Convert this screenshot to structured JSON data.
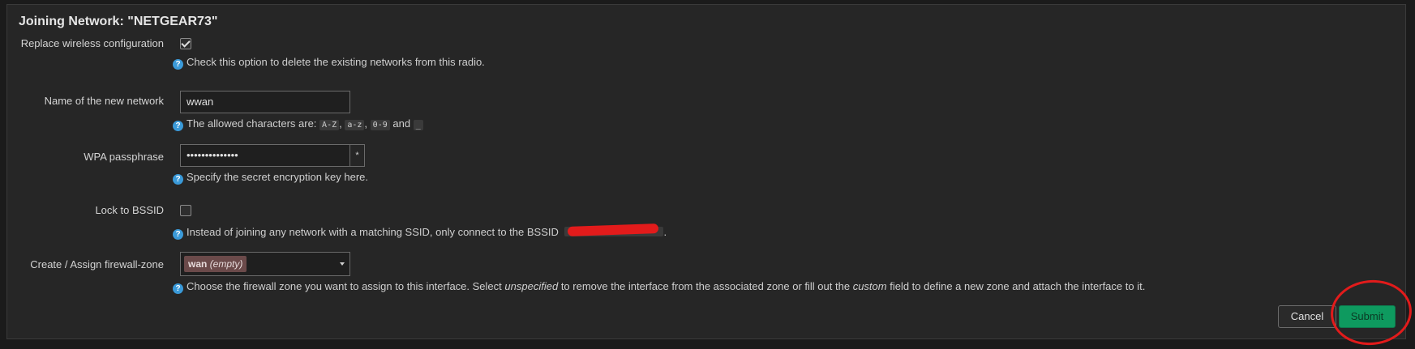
{
  "dialog": {
    "title": "Joining Network: \"NETGEAR73\""
  },
  "fields": {
    "replace": {
      "label": "Replace wireless configuration",
      "checked": true,
      "help": "Check this option to delete the existing networks from this radio."
    },
    "name": {
      "label": "Name of the new network",
      "value": "wwan",
      "help_prefix": "The allowed characters are:",
      "chars": [
        "A-Z",
        "a-z",
        "0-9",
        "_"
      ],
      "sep1": ",",
      "sep2": ",",
      "and": "and"
    },
    "passphrase": {
      "label": "WPA passphrase",
      "value": "••••••••••••••",
      "reveal_glyph": "*",
      "help": "Specify the secret encryption key here."
    },
    "bssid": {
      "label": "Lock to BSSID",
      "checked": false,
      "help": "Instead of joining any network with a matching SSID, only connect to the BSSID",
      "suffix": "."
    },
    "zone": {
      "label": "Create / Assign firewall-zone",
      "selected_name": "wan",
      "selected_note": "(empty)",
      "help_1": "Choose the firewall zone you want to assign to this interface. Select",
      "help_em1": "unspecified",
      "help_2": "to remove the interface from the associated zone or fill out the",
      "help_em2": "custom",
      "help_3": "field to define a new zone and attach the interface to it."
    }
  },
  "buttons": {
    "cancel": "Cancel",
    "submit": "Submit"
  },
  "colors": {
    "submit": "#0e9a5f",
    "annotation": "#e21b1b",
    "help_icon": "#3a9ad9"
  }
}
